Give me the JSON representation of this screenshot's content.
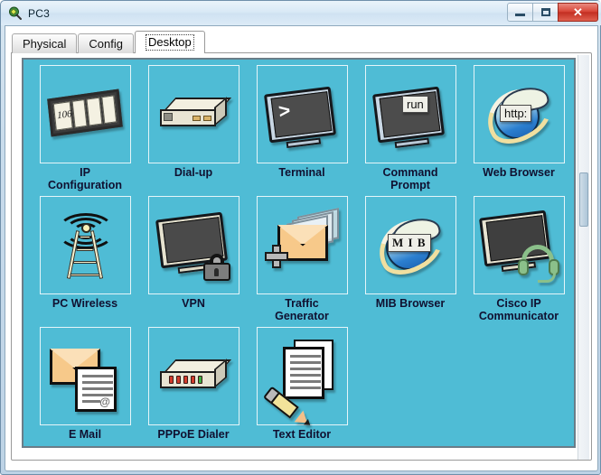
{
  "window": {
    "title": "PC3",
    "app_icon": "packet-tracer-icon",
    "controls": {
      "minimize": "–",
      "maximize": "□",
      "close": "✕"
    }
  },
  "tabs": [
    {
      "label": "Physical",
      "active": false
    },
    {
      "label": "Config",
      "active": false
    },
    {
      "label": "Desktop",
      "active": true
    }
  ],
  "desktop": {
    "background_color": "#4fbcd5",
    "label_color": "#101030",
    "items": [
      {
        "label": "IP\nConfiguration",
        "icon": "ip-configuration-icon",
        "badge": "106"
      },
      {
        "label": "Dial-up",
        "icon": "dial-up-modem-icon",
        "badge": ""
      },
      {
        "label": "Terminal",
        "icon": "terminal-icon",
        "badge": ">"
      },
      {
        "label": "Command\nPrompt",
        "icon": "command-prompt-icon",
        "badge": "run"
      },
      {
        "label": "Web Browser",
        "icon": "web-browser-icon",
        "badge": "http:"
      },
      {
        "label": "PC Wireless",
        "icon": "pc-wireless-icon",
        "badge": ""
      },
      {
        "label": "VPN",
        "icon": "vpn-icon",
        "badge": ""
      },
      {
        "label": "Traffic\nGenerator",
        "icon": "traffic-generator-icon",
        "badge": ""
      },
      {
        "label": "MIB Browser",
        "icon": "mib-browser-icon",
        "badge": "M I B"
      },
      {
        "label": "Cisco IP\nCommunicator",
        "icon": "cisco-ip-communicator-icon",
        "badge": ""
      },
      {
        "label": "E Mail",
        "icon": "email-icon",
        "badge": "@"
      },
      {
        "label": "PPPoE Dialer",
        "icon": "pppoe-dialer-icon",
        "badge": ""
      },
      {
        "label": "Text Editor",
        "icon": "text-editor-icon",
        "badge": ""
      }
    ]
  }
}
